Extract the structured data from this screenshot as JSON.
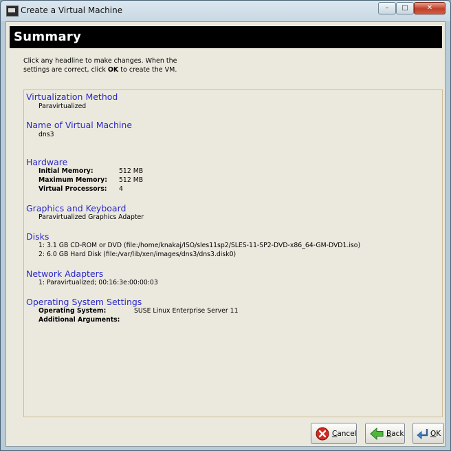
{
  "window": {
    "title": "Create a Virtual Machine",
    "controls": {
      "minimize": "–",
      "maximize": "□",
      "close": "✕"
    }
  },
  "header": {
    "title": "Summary"
  },
  "instructions": {
    "before_bold": "Click any headline to make changes.  When the settings are correct, click ",
    "bold": "OK",
    "after_bold": " to create the VM."
  },
  "sections": {
    "virtualization": {
      "title": "Virtualization Method",
      "value": "Paravirtualized"
    },
    "name": {
      "title": "Name of Virtual Machine",
      "value": "dns3"
    },
    "hardware": {
      "title": "Hardware",
      "initial_memory_label": "Initial Memory:",
      "initial_memory_value": "512 MB",
      "maximum_memory_label": "Maximum Memory:",
      "maximum_memory_value": "512 MB",
      "vcpu_label": "Virtual Processors:",
      "vcpu_value": "4"
    },
    "graphics": {
      "title": "Graphics and Keyboard",
      "value": "Paravirtualized Graphics Adapter"
    },
    "disks": {
      "title": "Disks",
      "items": [
        "1: 3.1 GB CD-ROM or DVD (file:/home/knakaj/ISO/sles11sp2/SLES-11-SP2-DVD-x86_64-GM-DVD1.iso)",
        "2: 6.0 GB Hard Disk (file:/var/lib/xen/images/dns3/dns3.disk0)"
      ]
    },
    "network": {
      "title": "Network Adapters",
      "items": [
        "1: Paravirtualized; 00:16:3e:00:00:03"
      ]
    },
    "os": {
      "title": "Operating System Settings",
      "os_label": "Operating System:",
      "os_value": "SUSE Linux Enterprise Server 11",
      "args_label": "Additional Arguments:",
      "args_value": ""
    }
  },
  "buttons": {
    "cancel": {
      "mnemonic": "C",
      "rest": "ancel"
    },
    "back": {
      "mnemonic": "B",
      "rest": "ack"
    },
    "ok": {
      "mnemonic": "O",
      "rest": "K"
    }
  },
  "colors": {
    "link": "#2929c9",
    "header_bg": "#000000",
    "panel_border": "#cdbb94"
  }
}
